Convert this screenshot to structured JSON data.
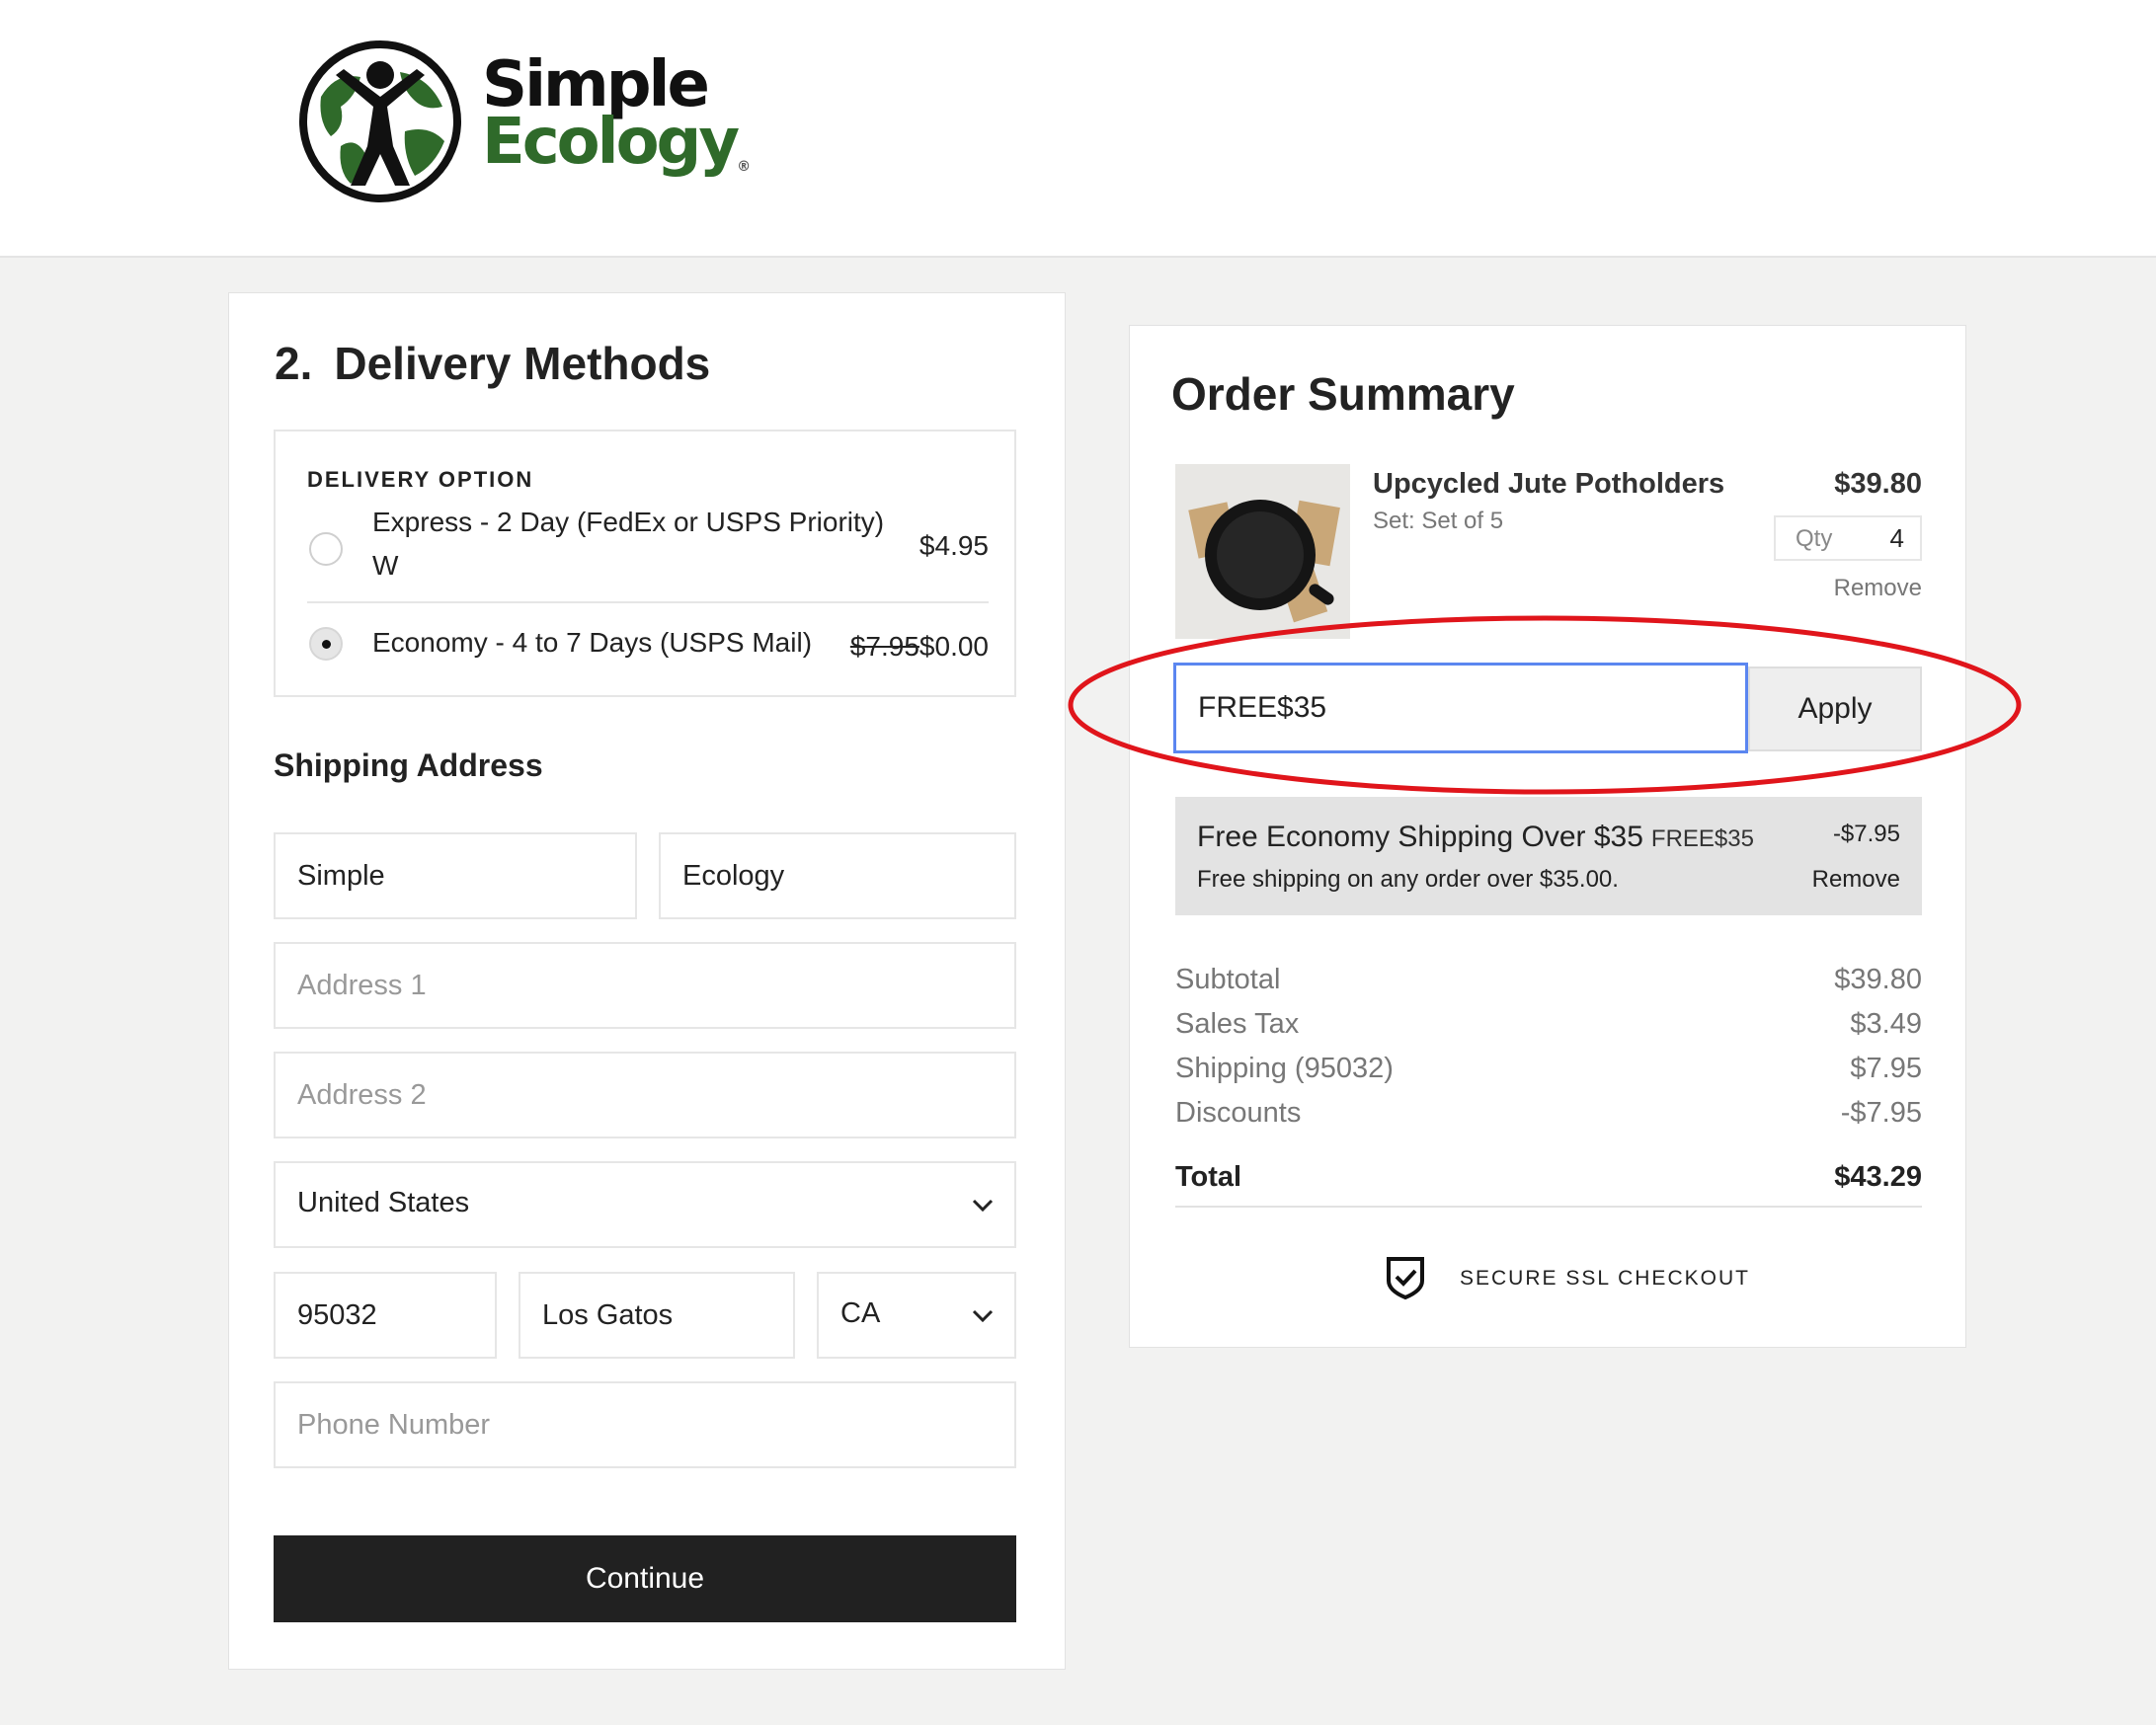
{
  "brand": {
    "name_line1": "Simple",
    "name_line2": "Ecology",
    "registered": "®"
  },
  "delivery": {
    "step_number": "2.",
    "title": "Delivery Methods",
    "option_heading": "DELIVERY OPTION",
    "options": [
      {
        "label": "Express - 2 Day (FedEx or USPS Priority) W",
        "price": "$4.95",
        "selected": false
      },
      {
        "label": "Economy - 4 to 7 Days (USPS Mail)",
        "original_price": "$7.95",
        "price": "$0.00",
        "selected": true
      }
    ]
  },
  "shipping": {
    "title": "Shipping Address",
    "first_name": "Simple",
    "last_name": "Ecology",
    "address1_placeholder": "Address 1",
    "address2_placeholder": "Address 2",
    "country": "United States",
    "zip": "95032",
    "city": "Los Gatos",
    "state": "CA",
    "phone_placeholder": "Phone Number",
    "continue_label": "Continue"
  },
  "summary": {
    "title": "Order Summary",
    "item": {
      "name": "Upcycled Jute Potholders",
      "variant": "Set: Set of 5",
      "price": "$39.80",
      "qty_label": "Qty",
      "qty": "4",
      "remove_label": "Remove"
    },
    "promo": {
      "code_value": "FREE$35",
      "apply_label": "Apply"
    },
    "discount": {
      "title": "Free Economy Shipping Over $35",
      "code": "FREE$35",
      "description": "Free shipping on any order over $35.00.",
      "amount": "-$7.95",
      "remove_label": "Remove"
    },
    "totals": {
      "subtotal_label": "Subtotal",
      "subtotal": "$39.80",
      "tax_label": "Sales Tax",
      "tax": "$3.49",
      "shipping_label": "Shipping (95032)",
      "shipping": "$7.95",
      "discounts_label": "Discounts",
      "discounts": "-$7.95",
      "total_label": "Total",
      "total": "$43.29"
    },
    "secure_label": "SECURE SSL CHECKOUT"
  },
  "colors": {
    "accent_dark": "#212121",
    "brand_green": "#2f6a2a",
    "focus_blue": "#5b86f0",
    "annotation_red": "#e0151b"
  }
}
